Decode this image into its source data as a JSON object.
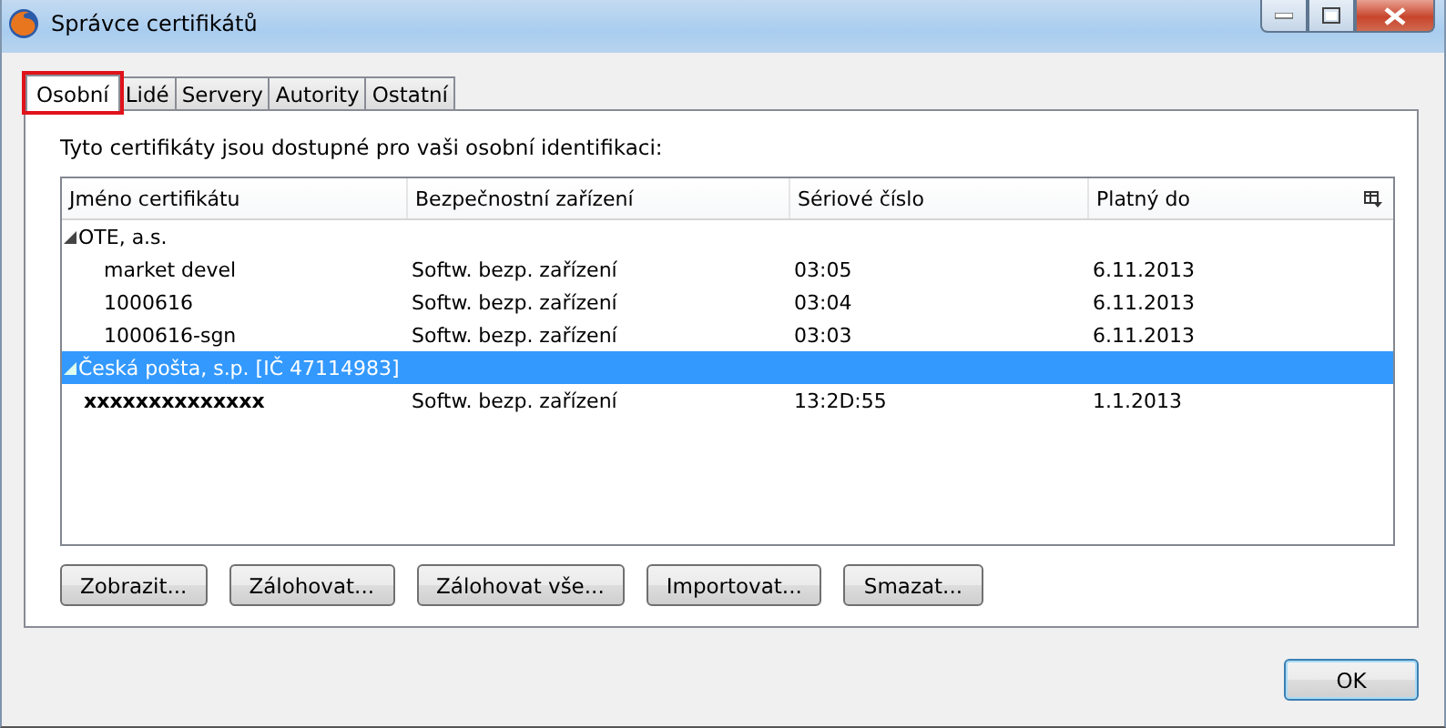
{
  "window": {
    "title": "Správce certifikátů"
  },
  "tabs": [
    {
      "label": "Osobní",
      "selected": true,
      "highlighted": true
    },
    {
      "label": "Lidé",
      "selected": false,
      "highlighted": false
    },
    {
      "label": "Servery",
      "selected": false,
      "highlighted": false
    },
    {
      "label": "Autority",
      "selected": false,
      "highlighted": false
    },
    {
      "label": "Ostatní",
      "selected": false,
      "highlighted": false
    }
  ],
  "description": "Tyto certifikáty jsou dostupné pro vaši osobní identifikaci:",
  "table": {
    "columns": [
      "Jméno certifikátu",
      "Bezpečnostní zařízení",
      "Sériové číslo",
      "Platný do"
    ],
    "groups": [
      {
        "name": "OTE, a.s.",
        "expanded": true,
        "selected": false,
        "children": [
          {
            "cells": [
              "market devel",
              "Softw. bezp. zařízení",
              "03:05",
              "6.11.2013"
            ],
            "bold": false
          },
          {
            "cells": [
              "1000616",
              "Softw. bezp. zařízení",
              "03:04",
              "6.11.2013"
            ],
            "bold": false
          },
          {
            "cells": [
              "1000616-sgn",
              "Softw. bezp. zařízení",
              "03:03",
              "6.11.2013"
            ],
            "bold": false
          }
        ]
      },
      {
        "name": "Česká pošta, s.p. [IČ 47114983]",
        "expanded": true,
        "selected": true,
        "children": [
          {
            "cells": [
              "xxxxxxxxxxxxxx",
              "Softw. bezp. zařízení",
              "13:2D:55",
              "1.1.2013"
            ],
            "bold": true
          }
        ]
      }
    ]
  },
  "buttons": [
    "Zobrazit...",
    "Zálohovat...",
    "Zálohovat vše...",
    "Importovat...",
    "Smazat..."
  ],
  "ok_button": "OK"
}
